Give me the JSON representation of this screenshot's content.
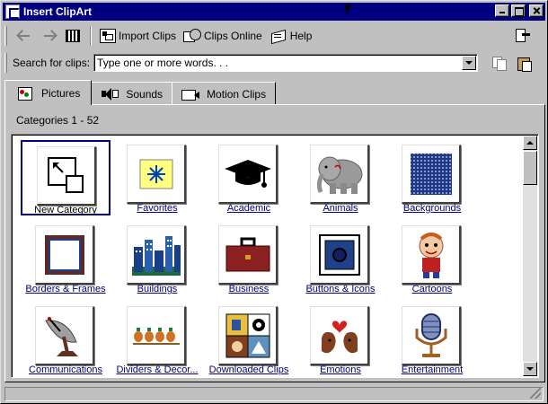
{
  "window": {
    "title": "Insert ClipArt"
  },
  "toolbar": {
    "import_label": "Import Clips",
    "online_label": "Clips Online",
    "help_label": "Help"
  },
  "search": {
    "label": "Search for clips:",
    "value": "Type one or more words. . ."
  },
  "tabs": [
    {
      "label": "Pictures",
      "icon": "pictures-icon",
      "active": true
    },
    {
      "label": "Sounds",
      "icon": "sounds-icon",
      "active": false
    },
    {
      "label": "Motion Clips",
      "icon": "motion-clips-icon",
      "active": false
    }
  ],
  "categories": {
    "count_label": "Categories 1 - 52",
    "items": [
      {
        "label": "New Category",
        "icon": "new-category-icon",
        "selected": true
      },
      {
        "label": "Favorites",
        "icon": "favorites-icon"
      },
      {
        "label": "Academic",
        "icon": "graduation-cap-icon"
      },
      {
        "label": "Animals",
        "icon": "elephant-icon"
      },
      {
        "label": "Backgrounds",
        "icon": "dotted-grid-icon"
      },
      {
        "label": "Borders & Frames",
        "icon": "frame-icon"
      },
      {
        "label": "Buildings",
        "icon": "city-skyline-icon"
      },
      {
        "label": "Business",
        "icon": "briefcase-icon"
      },
      {
        "label": "Buttons & Icons",
        "icon": "button-icon"
      },
      {
        "label": "Cartoons",
        "icon": "cartoon-boy-icon"
      },
      {
        "label": "Communications",
        "icon": "satellite-dish-icon"
      },
      {
        "label": "Dividers & Decor...",
        "icon": "divider-icon"
      },
      {
        "label": "Downloaded Clips",
        "icon": "collage-icon"
      },
      {
        "label": "Emotions",
        "icon": "faces-heart-icon"
      },
      {
        "label": "Entertainment",
        "icon": "microphone-icon"
      }
    ]
  },
  "colors": {
    "titlebar": "#000080",
    "face": "#c0c0c0",
    "link": "#000080"
  }
}
